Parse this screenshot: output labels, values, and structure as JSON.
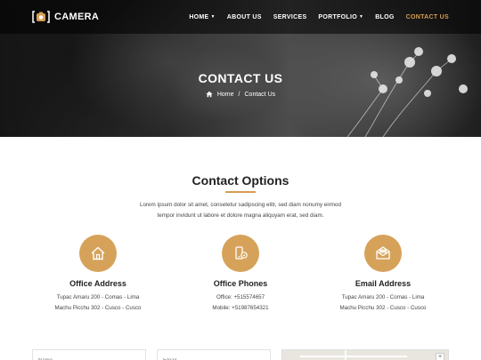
{
  "brand": {
    "name": "CAMERA"
  },
  "nav": {
    "items": [
      {
        "label": "HOME",
        "dropdown": true,
        "active": false
      },
      {
        "label": "ABOUT US",
        "dropdown": false,
        "active": false
      },
      {
        "label": "SERVICES",
        "dropdown": false,
        "active": false
      },
      {
        "label": "PORTFOLIO",
        "dropdown": true,
        "active": false
      },
      {
        "label": "BLOG",
        "dropdown": false,
        "active": false
      },
      {
        "label": "CONTACT US",
        "dropdown": false,
        "active": true
      }
    ]
  },
  "hero": {
    "title": "CONTACT US",
    "breadcrumb": {
      "home": "Home",
      "separator": "/",
      "current": "Contact Us"
    }
  },
  "contact": {
    "title": "Contact Options",
    "intro_line1": "Lorem ipsum dolor sit amet, consetetur sadipscing elitr, sed diam nonumy eirmod",
    "intro_line2": "tempor invidunt ut labore et dolore magna aliquyam erat, sed diam.",
    "cards": [
      {
        "icon": "house-icon",
        "title": "Office Address",
        "line1": "Tupac Amaru 200 - Comas - Lima",
        "line2": "Machu Picchu 302 - Cusco - Cusco"
      },
      {
        "icon": "phone-icon",
        "title": "Office Phones",
        "line1": "Office: +515574657",
        "line2": "Mobile: +51987654321"
      },
      {
        "icon": "envelope-icon",
        "title": "Email Address",
        "line1": "Tupac Amaru 200 - Comas - Lima",
        "line2": "Machu Picchu 302 - Cusco - Cusco"
      }
    ]
  },
  "form": {
    "name_placeholder": "Name",
    "email_placeholder": "Email",
    "map_zoom_label": "+"
  },
  "colors": {
    "accent": "#d79d52",
    "icon_circle": "#d6a25a",
    "nav_bg": "#000000"
  }
}
